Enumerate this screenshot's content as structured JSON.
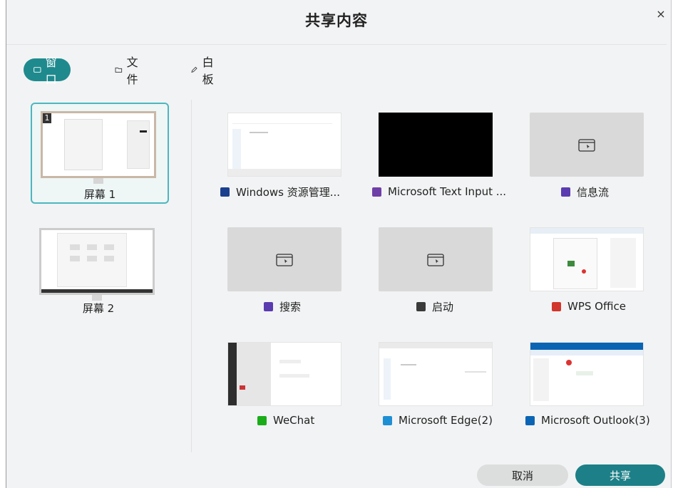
{
  "dialog": {
    "title": "共享内容",
    "close_glyph": "×"
  },
  "tabs": [
    {
      "label": "窗口",
      "icon": "window-icon",
      "active": true
    },
    {
      "label": "文件",
      "icon": "folder-icon",
      "active": false
    },
    {
      "label": "白板",
      "icon": "pen-icon",
      "active": false
    }
  ],
  "screens": [
    {
      "label": "屏幕 1",
      "badge": "1",
      "selected": true
    },
    {
      "label": "屏幕 2",
      "selected": false
    }
  ],
  "windows": [
    {
      "label": "Windows 资源管理...",
      "icon": "explorer-icon",
      "color": "#1b3f8f",
      "thumb": "page"
    },
    {
      "label": "Microsoft Text Input ...",
      "icon": "text-input-icon",
      "color": "#6f3fa8",
      "thumb": "black"
    },
    {
      "label": "信息流",
      "icon": "feed-icon",
      "color": "#5b3bb0",
      "thumb": "placeholder"
    },
    {
      "label": "搜索",
      "icon": "search-app-icon",
      "color": "#5b3bb0",
      "thumb": "placeholder"
    },
    {
      "label": "启动",
      "icon": "startup-icon",
      "color": "#3a3a3a",
      "thumb": "placeholder"
    },
    {
      "label": "WPS Office",
      "icon": "wps-icon",
      "color": "#d1352b",
      "thumb": "page"
    },
    {
      "label": "WeChat",
      "icon": "wechat-icon",
      "color": "#1aad19",
      "thumb": "page"
    },
    {
      "label": "Microsoft Edge(2)",
      "icon": "edge-icon",
      "color": "#1f8fd4",
      "thumb": "page"
    },
    {
      "label": "Microsoft Outlook(3)",
      "icon": "outlook-icon",
      "color": "#0a64b4",
      "thumb": "page"
    }
  ],
  "footer": {
    "cancel_label": "取消",
    "share_label": "共享"
  },
  "colors": {
    "accent": "#1e8a8e",
    "share_button": "#1d7f87",
    "selection_border": "#4cb7bf"
  }
}
